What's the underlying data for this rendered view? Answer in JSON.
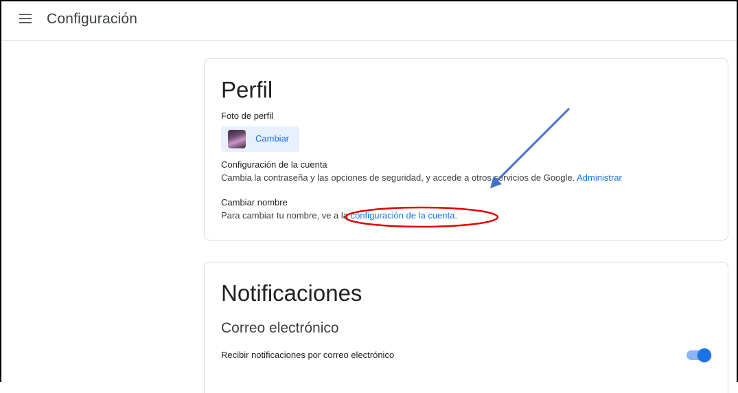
{
  "header": {
    "title": "Configuración",
    "menu_icon": "hamburger-menu-icon"
  },
  "profile": {
    "title": "Perfil",
    "photo_label": "Foto de perfil",
    "change_button": "Cambiar",
    "account_label": "Configuración de la cuenta",
    "account_text": "Cambia la contraseña y las opciones de seguridad, y accede a otros servicios de Google. ",
    "account_link": "Administrar",
    "name_label": "Cambiar nombre",
    "name_text": "Para cambiar tu nombre, ve a la ",
    "name_link": "configuración de la cuenta",
    "name_suffix": "."
  },
  "notifications": {
    "title": "Notificaciones",
    "email_title": "Correo electrónico",
    "email_option_label": "Recibir notificaciones por correo electrónico",
    "email_enabled": true
  },
  "annotations": {
    "arrow_color": "#4472c4",
    "circle_color": "#e00000"
  },
  "colors": {
    "accent": "#1a73e8",
    "accent_light": "#e8f0fe"
  }
}
